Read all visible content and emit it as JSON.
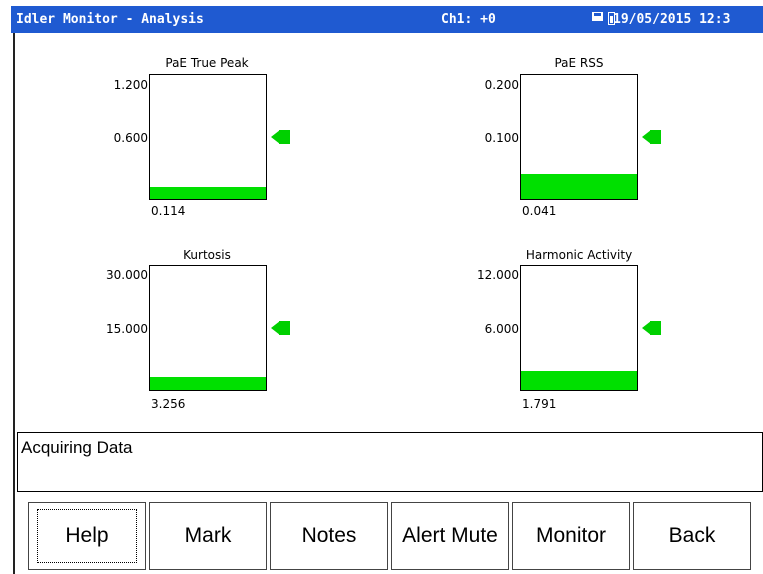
{
  "titlebar": {
    "title": "Idler Monitor - Analysis",
    "channel": "Ch1: +0",
    "datetime": "19/05/2015 12:3",
    "background": "#1f5ad1"
  },
  "gauges": [
    {
      "name": "pae-true-peak",
      "title": "PaE True Peak",
      "max_label": "1.200",
      "mid_label": "0.600",
      "value": "0.114",
      "max": 1.2,
      "level": 0.114,
      "alarm_level": 0.6
    },
    {
      "name": "pae-rss",
      "title": "PaE RSS",
      "max_label": "0.200",
      "mid_label": "0.100",
      "value": "0.041",
      "max": 0.2,
      "level": 0.041,
      "alarm_level": 0.1
    },
    {
      "name": "kurtosis",
      "title": "Kurtosis",
      "max_label": "30.000",
      "mid_label": "15.000",
      "value": "3.256",
      "max": 30,
      "level": 3.256,
      "alarm_level": 15
    },
    {
      "name": "harmonic-activity",
      "title": "Harmonic Activity",
      "max_label": "12.000",
      "mid_label": "6.000",
      "value": "1.791",
      "max": 12,
      "level": 1.791,
      "alarm_level": 6
    }
  ],
  "fill_color": "#00e000",
  "status": {
    "text": "Acquiring Data"
  },
  "buttons": [
    {
      "label": "Help"
    },
    {
      "label": "Mark"
    },
    {
      "label": "Notes"
    },
    {
      "label": "Alert Mute"
    },
    {
      "label": "Monitor"
    },
    {
      "label": "Back"
    }
  ]
}
